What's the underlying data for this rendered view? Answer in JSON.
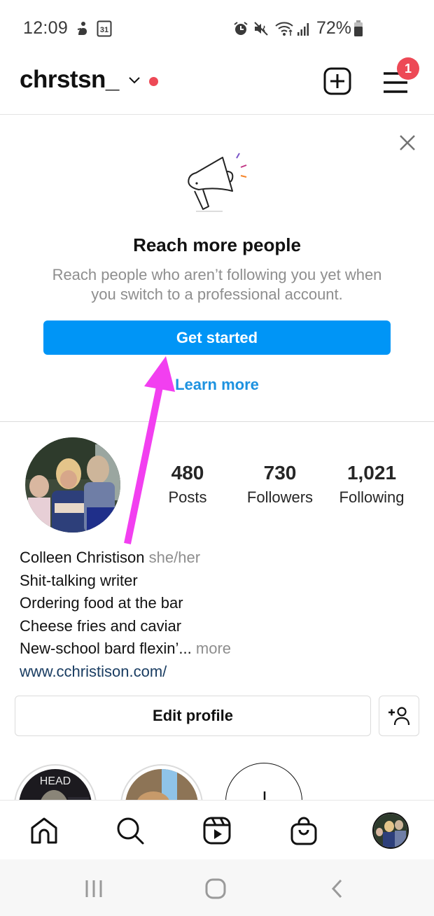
{
  "status_bar": {
    "time": "12:09",
    "calendar_day": "31",
    "battery": "72%",
    "icons": [
      "accessibility-icon",
      "calendar-icon",
      "alarm-icon",
      "mute-icon",
      "wifi-icon",
      "signal-icon",
      "battery-icon"
    ]
  },
  "header": {
    "username": "chrstsn_",
    "menu_badge_count": "1"
  },
  "promo": {
    "title": "Reach more people",
    "description": "Reach people who aren’t following you yet when you switch to a professional account.",
    "primary_button": "Get started",
    "secondary_link": "Learn more"
  },
  "profile": {
    "stats": [
      {
        "value": "480",
        "label": "Posts"
      },
      {
        "value": "730",
        "label": "Followers"
      },
      {
        "value": "1,021",
        "label": "Following"
      }
    ],
    "name": "Colleen Christison",
    "pronouns": "she/her",
    "bio_lines": [
      "Shit-talking writer",
      "Ordering food at the bar",
      "Cheese fries and caviar"
    ],
    "bio_last_line": "New-school bard flexin’...",
    "more_label": " more",
    "website": "www.cchristison.com/",
    "edit_profile_label": "Edit profile"
  },
  "highlights": [
    {
      "overlay_text": "HEAD"
    },
    {
      "overlay_text": ""
    },
    {
      "overlay_text": ""
    }
  ],
  "bottom_nav": [
    "home",
    "search",
    "reels",
    "shop",
    "profile"
  ],
  "colors": {
    "accent_blue": "#0095f6",
    "link_blue": "#1d92e0",
    "badge_red": "#ed4956",
    "annotation_magenta": "#f23ff0"
  }
}
